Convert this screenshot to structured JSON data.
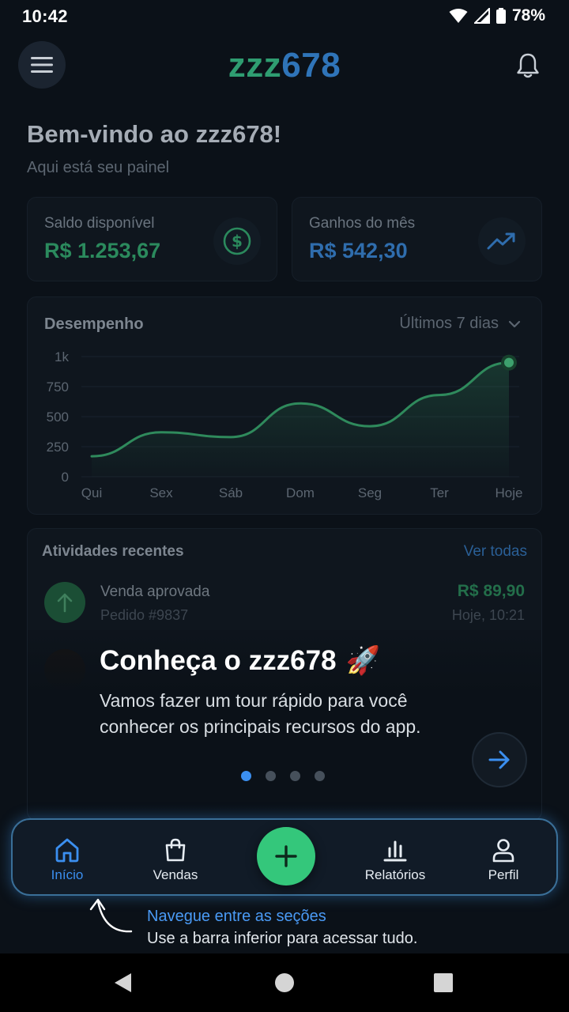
{
  "status_bar": {
    "time": "10:42",
    "battery": "78%"
  },
  "header": {
    "logo_letters": "zzz",
    "logo_digits": "678"
  },
  "welcome": {
    "title": "Bem-vindo ao zzz678!",
    "subtitle": "Aqui está seu painel"
  },
  "stats": [
    {
      "label": "Saldo disponível",
      "value": "R$ 1.253,67",
      "icon": "dollar-circle-icon",
      "color": "#2b8a5d"
    },
    {
      "label": "Ganhos do mês",
      "value": "R$ 542,30",
      "icon": "trending-up-icon",
      "color": "#2f6dad"
    }
  ],
  "performance": {
    "title": "Desempenho",
    "range_selector": "Últimos 7 dias"
  },
  "chart_data": {
    "type": "area",
    "categories": [
      "Qui",
      "Sex",
      "Sáb",
      "Dom",
      "Seg",
      "Ter",
      "Hoje"
    ],
    "values": [
      170,
      370,
      330,
      610,
      420,
      680,
      950
    ],
    "ylim": [
      0,
      1000
    ],
    "yticks": [
      "0",
      "250",
      "500",
      "750",
      "1k"
    ],
    "grid": true,
    "color": "#2f8a5c"
  },
  "activities": {
    "title": "Atividades recentes",
    "view_all": "Ver todas",
    "items": [
      {
        "name": "Venda aprovada",
        "order": "Pedido #9837",
        "amount": "R$ 89,90",
        "time": "Hoje, 10:21"
      }
    ]
  },
  "tour": {
    "title": "Conheça o zzz678",
    "emoji": "🚀",
    "text": "Vamos fazer um tour rápido para você conhecer os principais recursos do app.",
    "step": 1,
    "total_steps": 4
  },
  "bottom_nav": {
    "items": [
      {
        "label": "Início",
        "icon": "home-icon",
        "active": true
      },
      {
        "label": "Vendas",
        "icon": "shopping-bag-icon",
        "active": false
      },
      {
        "label": "Relatórios",
        "icon": "bar-chart-icon",
        "active": false
      },
      {
        "label": "Perfil",
        "icon": "user-icon",
        "active": false
      }
    ],
    "add_icon": "plus-icon"
  },
  "hint": {
    "title": "Navegue entre as seções",
    "text": "Use a barra inferior para acessar tudo."
  }
}
